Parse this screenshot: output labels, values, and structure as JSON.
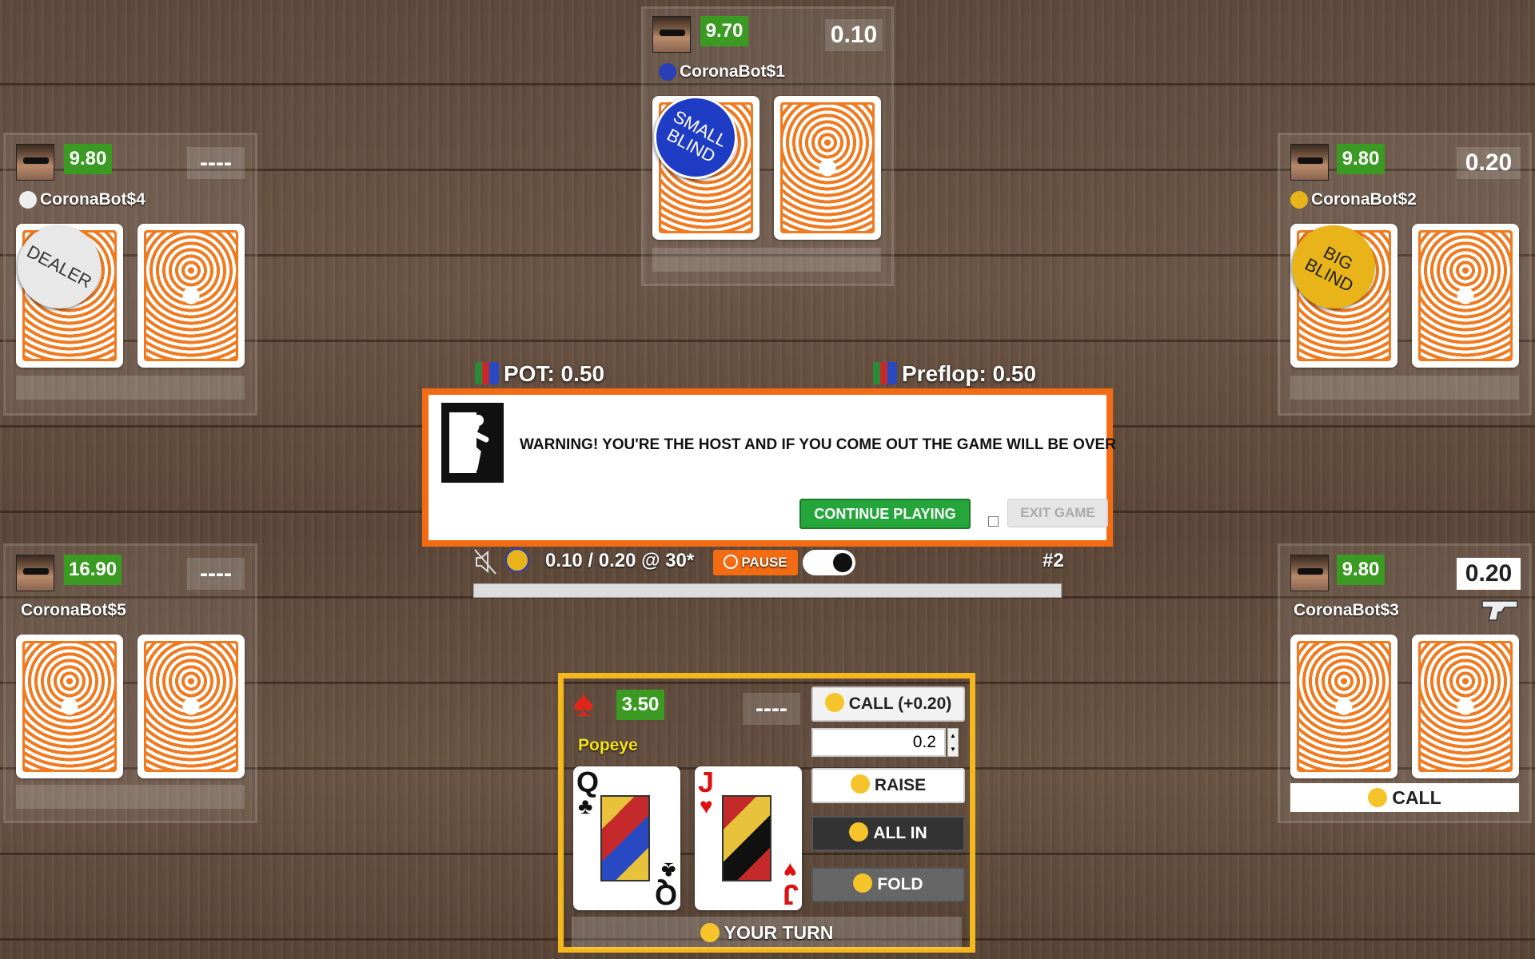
{
  "players": {
    "top": {
      "name": "CoronaBot$1",
      "chips": "9.70",
      "bet": "0.10",
      "badge": "SMALL BLIND"
    },
    "left": {
      "name": "CoronaBot$4",
      "chips": "9.80",
      "bet": "----",
      "badge": "DEALER"
    },
    "right": {
      "name": "CoronaBot$2",
      "chips": "9.80",
      "bet": "0.20",
      "badge": "BIG BLIND"
    },
    "bottom_left": {
      "name": "CoronaBot$5",
      "chips": "16.90",
      "bet": "----"
    },
    "bottom_right": {
      "name": "CoronaBot$3",
      "chips": "9.80",
      "bet": "0.20",
      "last_action": "CALL"
    }
  },
  "pot": {
    "label": "POT: 0.50",
    "round": "Preflop: 0.50"
  },
  "modal": {
    "message": "WARNING! YOU'RE THE HOST AND IF YOU COME OUT THE GAME WILL BE OVER",
    "continue_label": "CONTINUE PLAYING",
    "exit_label": "EXIT GAME"
  },
  "status": {
    "blinds": "0.10 / 0.20 @ 30*",
    "pause_label": "PAUSE",
    "hand_number": "#2"
  },
  "hero": {
    "name": "Popeye",
    "chips": "3.50",
    "bet": "----",
    "cards": [
      {
        "rank": "Q",
        "suit": "♣",
        "color": "#111"
      },
      {
        "rank": "J",
        "suit": "♥",
        "color": "#d11"
      }
    ],
    "call_label": "CALL (+0.20)",
    "raise_value": "0.2",
    "raise_label": "RAISE",
    "allin_label": "ALL IN",
    "fold_label": "FOLD",
    "turn_label": "YOUR TURN"
  },
  "colors": {
    "chips_green": "#3a9a22",
    "modal_border": "#f36b12",
    "hero_border": "#f5b81c",
    "card_back": "#f07a20"
  }
}
